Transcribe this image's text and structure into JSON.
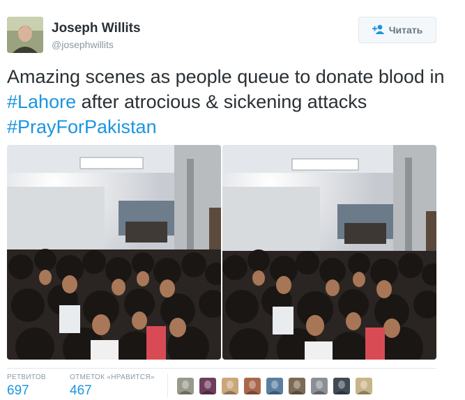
{
  "author": {
    "name": "Joseph Willits",
    "handle": "@josephwillits"
  },
  "follow_button": {
    "label": "Читать",
    "icon": "follow-user-icon"
  },
  "tweet": {
    "text_parts": [
      "Amazing scenes as people queue to donate blood in ",
      "#Lahore",
      " after atrocious & sickening attacks ",
      "#PrayForPakistan"
    ]
  },
  "photos": [
    {
      "icon": "crowd-photo"
    },
    {
      "icon": "crowd-photo"
    }
  ],
  "stats": {
    "retweets_label": "РЕТВИТОВ",
    "retweets_count": "697",
    "likes_label": "ОТМЕТОК «НРАВИТСЯ»",
    "likes_count": "467"
  },
  "likers": [
    {
      "color": "#9a9a8c"
    },
    {
      "color": "#6f3d5c"
    },
    {
      "color": "#c9a77a"
    },
    {
      "color": "#a9674c"
    },
    {
      "color": "#5a7fa0"
    },
    {
      "color": "#7c6a55"
    },
    {
      "color": "#8c8f96"
    },
    {
      "color": "#3f4a55"
    },
    {
      "color": "#c8b48a"
    }
  ],
  "colors": {
    "link": "#1b95e0",
    "text": "#292f33",
    "muted": "#8899a6"
  }
}
